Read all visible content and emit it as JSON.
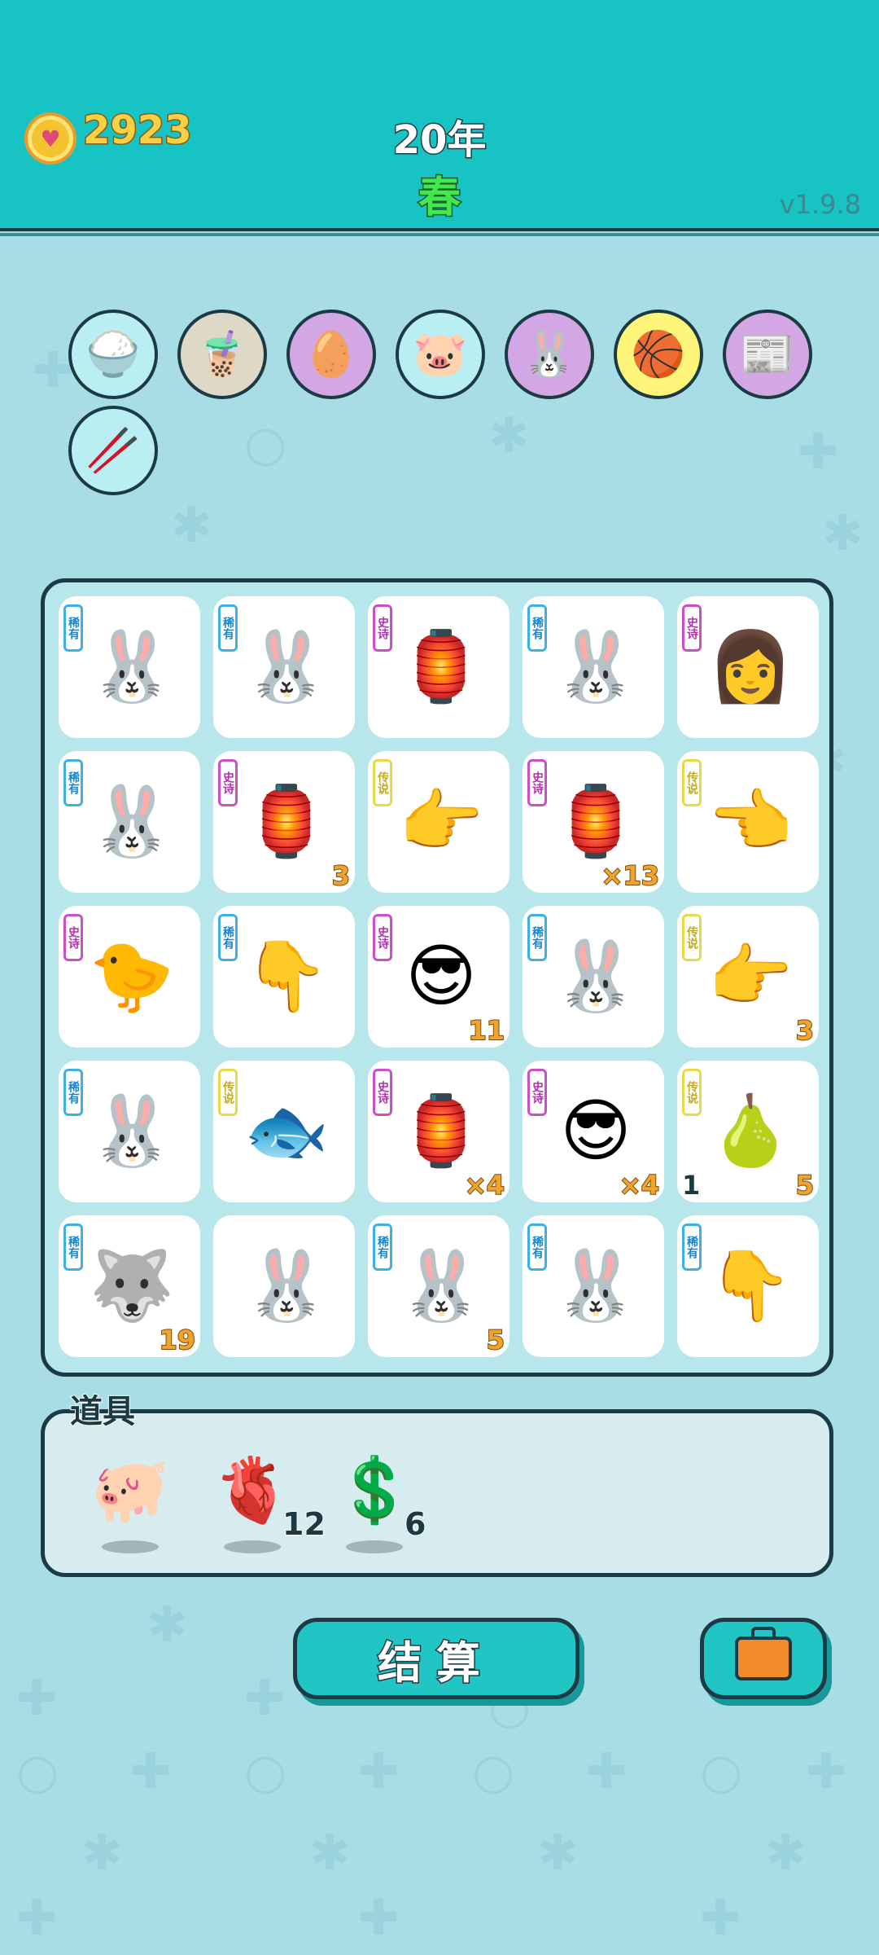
{
  "header": {
    "coins": "2923",
    "year": "20年",
    "season": "春",
    "version": "v1.9.8",
    "coin_icon": "heart-coin-icon"
  },
  "buffs": [
    {
      "icon": "rice-bowl-icon",
      "glyph": "🍚",
      "color": "blue"
    },
    {
      "icon": "bubble-tea-icon",
      "glyph": "🧋",
      "color": "gray"
    },
    {
      "icon": "egg-icon",
      "glyph": "🥚",
      "color": "purple"
    },
    {
      "icon": "piggy-bank-icon",
      "glyph": "🐷",
      "color": "blue"
    },
    {
      "icon": "rabbit-icon",
      "glyph": "🐰",
      "color": "purple"
    },
    {
      "icon": "basketball-icon",
      "glyph": "🏀",
      "color": "yellow"
    },
    {
      "icon": "time-magazine-icon",
      "glyph": "📰",
      "color": "purple"
    },
    {
      "icon": "chopsticks-icon",
      "glyph": "🥢",
      "color": "blue"
    }
  ],
  "tags": {
    "rare": "稀有",
    "epic": "史诗",
    "legend": "传说"
  },
  "board": [
    {
      "tag": "rare",
      "icon": "rabbit-icon",
      "glyph": "🐰",
      "count": ""
    },
    {
      "tag": "rare",
      "icon": "rabbit-icon",
      "glyph": "🐰",
      "count": ""
    },
    {
      "tag": "epic",
      "icon": "rabbit-house-icon",
      "glyph": "🏮",
      "count": ""
    },
    {
      "tag": "rare",
      "icon": "rabbit-icon",
      "glyph": "🐰",
      "count": ""
    },
    {
      "tag": "epic",
      "icon": "girl-portrait-icon",
      "glyph": "👩",
      "count": ""
    },
    {
      "tag": "rare",
      "icon": "rabbit-icon",
      "glyph": "🐰",
      "count": ""
    },
    {
      "tag": "epic",
      "icon": "rabbit-house-icon",
      "glyph": "🏮",
      "count": "3"
    },
    {
      "tag": "legend",
      "icon": "pointing-hand-right-icon",
      "glyph": "👉",
      "count": ""
    },
    {
      "tag": "epic",
      "icon": "rabbit-house-icon",
      "glyph": "🏮",
      "count": "×13"
    },
    {
      "tag": "legend",
      "icon": "pointing-hand-left-icon",
      "glyph": "👈",
      "count": ""
    },
    {
      "tag": "epic",
      "icon": "chick-with-hair-icon",
      "glyph": "🐤",
      "count": ""
    },
    {
      "tag": "rare",
      "icon": "pointing-hand-down-icon",
      "glyph": "👇",
      "count": ""
    },
    {
      "tag": "epic",
      "icon": "green-hat-man-icon",
      "glyph": "😎",
      "count": "11"
    },
    {
      "tag": "rare",
      "icon": "rabbit-icon",
      "glyph": "🐰",
      "count": ""
    },
    {
      "tag": "legend",
      "icon": "pointing-hand-right-icon",
      "glyph": "👉",
      "count": "3"
    },
    {
      "tag": "rare",
      "icon": "rabbit-icon",
      "glyph": "🐰",
      "count": ""
    },
    {
      "tag": "legend",
      "icon": "koi-fish-icon",
      "glyph": "🐟",
      "count": ""
    },
    {
      "tag": "epic",
      "icon": "rabbit-house-icon",
      "glyph": "🏮",
      "count": "×4"
    },
    {
      "tag": "epic",
      "icon": "green-hat-man-icon",
      "glyph": "😎",
      "count": "×4"
    },
    {
      "tag": "legend",
      "icon": "pear-icon",
      "glyph": "🍐",
      "count": "5",
      "count_left": "1"
    },
    {
      "tag": "rare",
      "icon": "husky-dog-icon",
      "glyph": "🐺",
      "count": "19"
    },
    {
      "tag": "",
      "icon": "rabbit-icon",
      "glyph": "🐰",
      "count": ""
    },
    {
      "tag": "rare",
      "icon": "rabbit-icon",
      "glyph": "🐰",
      "count": "5"
    },
    {
      "tag": "rare",
      "icon": "rabbit-icon",
      "glyph": "🐰",
      "count": ""
    },
    {
      "tag": "rare",
      "icon": "pointing-hand-down-icon",
      "glyph": "👇",
      "count": ""
    }
  ],
  "items": {
    "title": "道具",
    "list": [
      {
        "icon": "piggy-bank-icon",
        "glyph": "🐖",
        "count": ""
      },
      {
        "icon": "liver-icon",
        "glyph": "🫀",
        "count": "12"
      },
      {
        "icon": "dollar-coin-icon",
        "glyph": "💲",
        "count": "6"
      }
    ]
  },
  "buttons": {
    "settle": "结算",
    "bag_icon": "briefcase-icon"
  },
  "colors": {
    "header": "#18c3c3",
    "background": "#a9dde5",
    "outline": "#1b3a44",
    "coin_text": "#f7d043",
    "season_text": "#42e84d",
    "count_text": "#f1a32c"
  }
}
